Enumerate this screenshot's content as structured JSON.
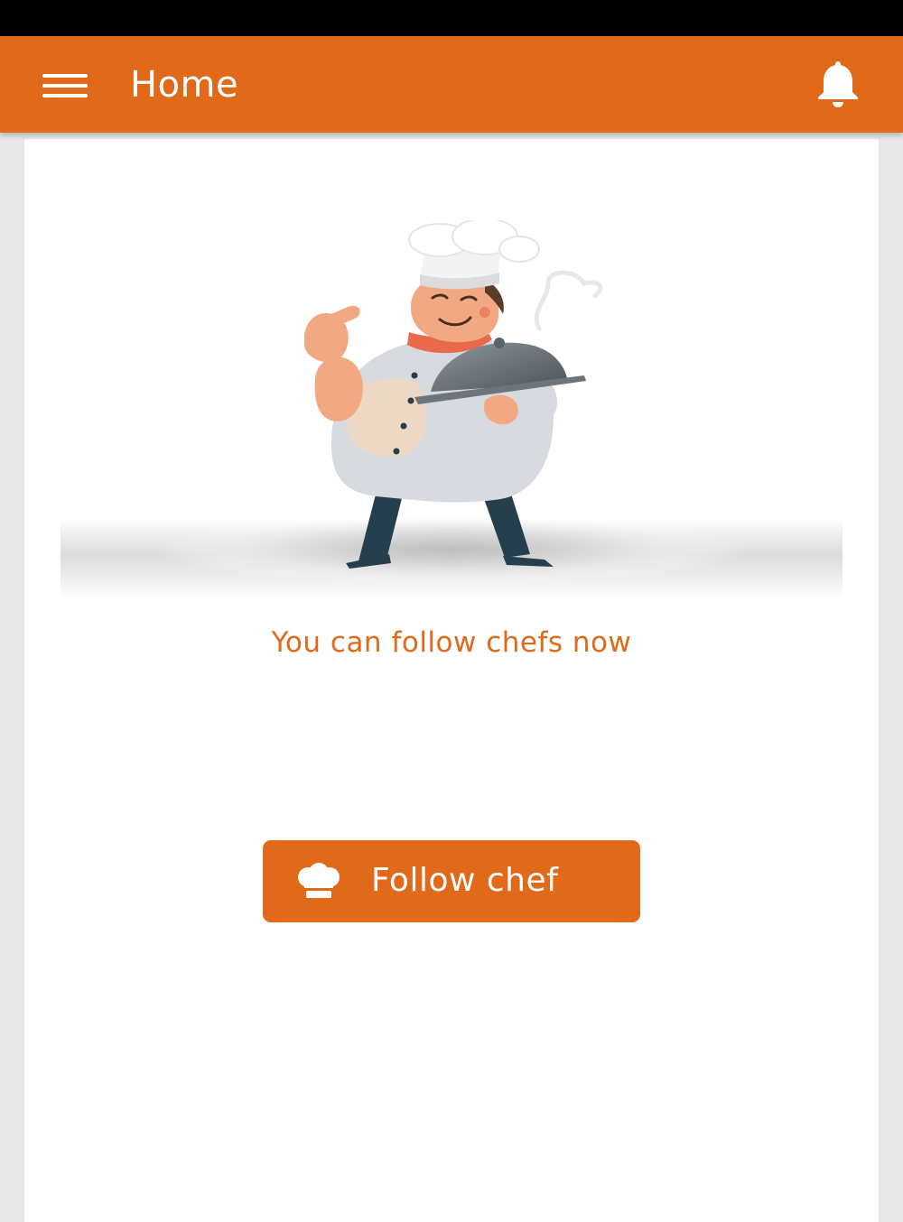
{
  "app_bar": {
    "title": "Home",
    "menu_icon": "hamburger-menu-icon",
    "notification_icon": "bell-icon",
    "color": "#e0691a"
  },
  "content": {
    "illustration": "chef-holding-cloche-illustration",
    "message": "You can follow chefs now",
    "follow_button": {
      "label": "Follow chef",
      "icon": "chef-hat-icon"
    }
  },
  "colors": {
    "accent": "#e0691a",
    "background": "#e8e8e8",
    "card": "#ffffff"
  }
}
